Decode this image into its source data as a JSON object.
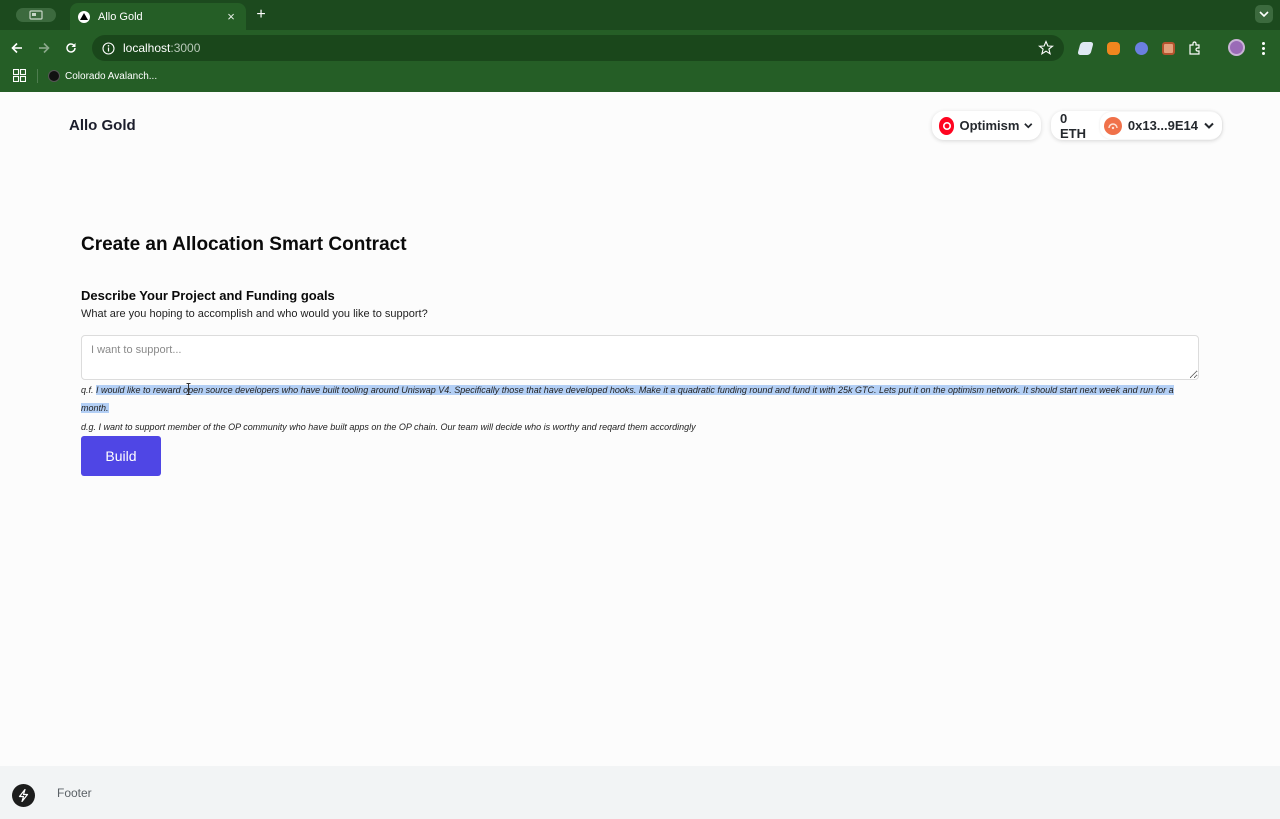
{
  "browser": {
    "tab_title": "Allo Gold",
    "tab_close": "×",
    "new_tab": "+",
    "url_host": "localhost",
    "url_port": ":3000",
    "bookmark_label": "Colorado Avalanch..."
  },
  "header": {
    "brand": "Allo Gold",
    "network_label": "Optimism",
    "balance": "0 ETH",
    "address": "0x13...9E14"
  },
  "main": {
    "title": "Create an Allocation Smart Contract",
    "section_title": "Describe Your Project and Funding goals",
    "section_subtitle": "What are you hoping to accomplish and who would you like to support?",
    "input_placeholder": "I want to support...",
    "input_value": "",
    "examples": [
      {
        "prefix": "q.f.",
        "text": "I would like to reward open source developers who have built tooling around Uniswap V4. Specifically those that have developed hooks. Make it a quadratic funding round and fund it with 25k GTC. Lets put it on the optimism network. It should start next week and run for a month."
      },
      {
        "prefix": "d.g.",
        "text": "I want to support member of the OP community who have built apps on the OP chain. Our team will decide who is worthy and reqard them accordingly"
      }
    ],
    "build_label": "Build"
  },
  "footer": {
    "label": "Footer"
  },
  "colors": {
    "chrome_green": "#255e26",
    "accent": "#4f46e5",
    "optimism_red": "#ff0420",
    "selection": "#b3cff5"
  },
  "icons": [
    "back-icon",
    "forward-icon",
    "reload-icon",
    "info-icon",
    "star-icon",
    "apps-icon",
    "chevron-down-icon",
    "bolt-icon",
    "kebab-menu-icon"
  ]
}
